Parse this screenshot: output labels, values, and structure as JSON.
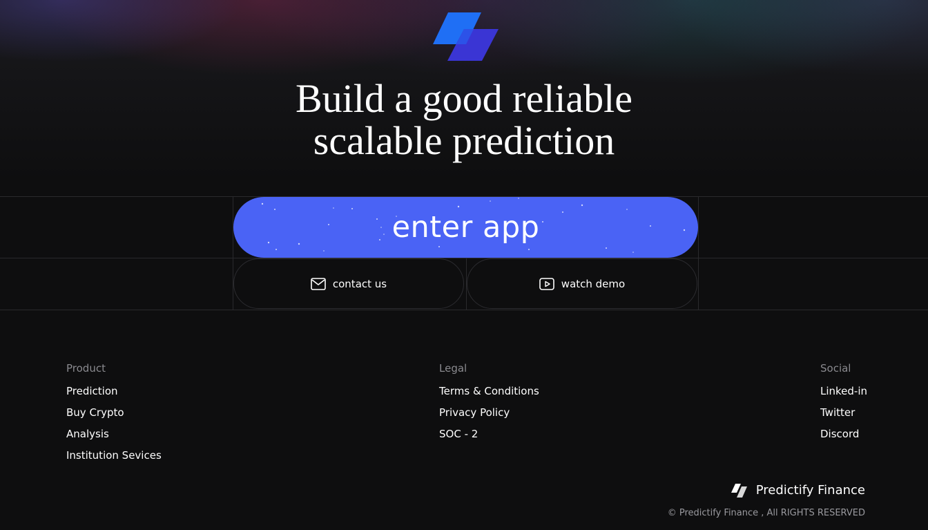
{
  "hero": {
    "headline_line1": "Build a good reliable",
    "headline_line2": "scalable prediction"
  },
  "actions": {
    "enter_app": "enter app",
    "contact": {
      "label": "contact us",
      "icon": "mail-icon"
    },
    "demo": {
      "label": "watch demo",
      "icon": "play-icon"
    }
  },
  "footer": {
    "product": {
      "heading": "Product",
      "links": [
        "Prediction",
        "Buy Crypto",
        "Analysis",
        "Institution Sevices"
      ]
    },
    "legal": {
      "heading": "Legal",
      "links": [
        "Terms & Conditions",
        "Privacy Policy",
        "SOC - 2"
      ]
    },
    "social": {
      "heading": "Social",
      "links": [
        "Linked-in",
        "Twitter",
        "Discord"
      ]
    },
    "brand_name": "Predictify Finance",
    "copyright": "© Predictify Finance , All RIGHTS RESERVED"
  },
  "colors": {
    "accent": "#4a63f5",
    "logo_light": "#1f6ff5",
    "logo_dark": "#3a35d4",
    "background": "#0e0e0f"
  }
}
